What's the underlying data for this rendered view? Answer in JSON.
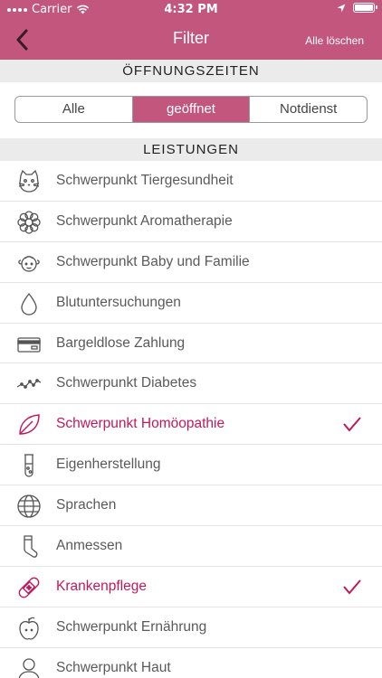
{
  "status": {
    "carrier": "Carrier",
    "time": "4:32 PM"
  },
  "nav": {
    "title": "Filter",
    "clear_all": "Alle löschen"
  },
  "sections": {
    "opening_hours": "ÖFFNUNGSZEITEN",
    "services": "LEISTUNGEN"
  },
  "segments": {
    "all": "Alle",
    "open": "geöffnet",
    "emergency": "Notdienst",
    "selected": "geöffnet"
  },
  "colors": {
    "accent": "#c2567d",
    "selected_text": "#c2185b"
  },
  "services": [
    {
      "label": "Schwerpunkt Tiergesundheit",
      "icon": "cat-icon",
      "selected": false
    },
    {
      "label": "Schwerpunkt Aromatherapie",
      "icon": "flower-icon",
      "selected": false
    },
    {
      "label": "Schwerpunkt Baby und Familie",
      "icon": "baby-icon",
      "selected": false
    },
    {
      "label": "Blutuntersuchungen",
      "icon": "drop-icon",
      "selected": false
    },
    {
      "label": "Bargeldlose Zahlung",
      "icon": "card-icon",
      "selected": false
    },
    {
      "label": "Schwerpunkt Diabetes",
      "icon": "pulse-icon",
      "selected": false
    },
    {
      "label": "Schwerpunkt Homöopathie",
      "icon": "leaf-icon",
      "selected": true
    },
    {
      "label": "Eigenherstellung",
      "icon": "test-tube-icon",
      "selected": false
    },
    {
      "label": "Sprachen",
      "icon": "globe-icon",
      "selected": false
    },
    {
      "label": "Anmessen",
      "icon": "sock-icon",
      "selected": false
    },
    {
      "label": "Krankenpflege",
      "icon": "bandage-icon",
      "selected": true
    },
    {
      "label": "Schwerpunkt Ernährung",
      "icon": "apple-icon",
      "selected": false
    },
    {
      "label": "Schwerpunkt Haut",
      "icon": "person-icon",
      "selected": false
    }
  ]
}
